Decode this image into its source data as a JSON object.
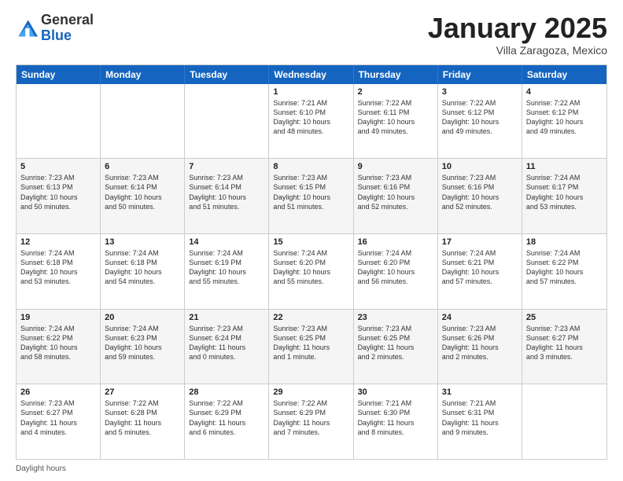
{
  "header": {
    "logo_general": "General",
    "logo_blue": "Blue",
    "month_title": "January 2025",
    "subtitle": "Villa Zaragoza, Mexico"
  },
  "days_of_week": [
    "Sunday",
    "Monday",
    "Tuesday",
    "Wednesday",
    "Thursday",
    "Friday",
    "Saturday"
  ],
  "footer_text": "Daylight hours",
  "rows": [
    [
      {
        "day": "",
        "info": "",
        "shaded": false
      },
      {
        "day": "",
        "info": "",
        "shaded": false
      },
      {
        "day": "",
        "info": "",
        "shaded": false
      },
      {
        "day": "1",
        "info": "Sunrise: 7:21 AM\nSunset: 6:10 PM\nDaylight: 10 hours\nand 48 minutes.",
        "shaded": false
      },
      {
        "day": "2",
        "info": "Sunrise: 7:22 AM\nSunset: 6:11 PM\nDaylight: 10 hours\nand 49 minutes.",
        "shaded": false
      },
      {
        "day": "3",
        "info": "Sunrise: 7:22 AM\nSunset: 6:12 PM\nDaylight: 10 hours\nand 49 minutes.",
        "shaded": false
      },
      {
        "day": "4",
        "info": "Sunrise: 7:22 AM\nSunset: 6:12 PM\nDaylight: 10 hours\nand 49 minutes.",
        "shaded": false
      }
    ],
    [
      {
        "day": "5",
        "info": "Sunrise: 7:23 AM\nSunset: 6:13 PM\nDaylight: 10 hours\nand 50 minutes.",
        "shaded": true
      },
      {
        "day": "6",
        "info": "Sunrise: 7:23 AM\nSunset: 6:14 PM\nDaylight: 10 hours\nand 50 minutes.",
        "shaded": true
      },
      {
        "day": "7",
        "info": "Sunrise: 7:23 AM\nSunset: 6:14 PM\nDaylight: 10 hours\nand 51 minutes.",
        "shaded": true
      },
      {
        "day": "8",
        "info": "Sunrise: 7:23 AM\nSunset: 6:15 PM\nDaylight: 10 hours\nand 51 minutes.",
        "shaded": true
      },
      {
        "day": "9",
        "info": "Sunrise: 7:23 AM\nSunset: 6:16 PM\nDaylight: 10 hours\nand 52 minutes.",
        "shaded": true
      },
      {
        "day": "10",
        "info": "Sunrise: 7:23 AM\nSunset: 6:16 PM\nDaylight: 10 hours\nand 52 minutes.",
        "shaded": true
      },
      {
        "day": "11",
        "info": "Sunrise: 7:24 AM\nSunset: 6:17 PM\nDaylight: 10 hours\nand 53 minutes.",
        "shaded": true
      }
    ],
    [
      {
        "day": "12",
        "info": "Sunrise: 7:24 AM\nSunset: 6:18 PM\nDaylight: 10 hours\nand 53 minutes.",
        "shaded": false
      },
      {
        "day": "13",
        "info": "Sunrise: 7:24 AM\nSunset: 6:18 PM\nDaylight: 10 hours\nand 54 minutes.",
        "shaded": false
      },
      {
        "day": "14",
        "info": "Sunrise: 7:24 AM\nSunset: 6:19 PM\nDaylight: 10 hours\nand 55 minutes.",
        "shaded": false
      },
      {
        "day": "15",
        "info": "Sunrise: 7:24 AM\nSunset: 6:20 PM\nDaylight: 10 hours\nand 55 minutes.",
        "shaded": false
      },
      {
        "day": "16",
        "info": "Sunrise: 7:24 AM\nSunset: 6:20 PM\nDaylight: 10 hours\nand 56 minutes.",
        "shaded": false
      },
      {
        "day": "17",
        "info": "Sunrise: 7:24 AM\nSunset: 6:21 PM\nDaylight: 10 hours\nand 57 minutes.",
        "shaded": false
      },
      {
        "day": "18",
        "info": "Sunrise: 7:24 AM\nSunset: 6:22 PM\nDaylight: 10 hours\nand 57 minutes.",
        "shaded": false
      }
    ],
    [
      {
        "day": "19",
        "info": "Sunrise: 7:24 AM\nSunset: 6:22 PM\nDaylight: 10 hours\nand 58 minutes.",
        "shaded": true
      },
      {
        "day": "20",
        "info": "Sunrise: 7:24 AM\nSunset: 6:23 PM\nDaylight: 10 hours\nand 59 minutes.",
        "shaded": true
      },
      {
        "day": "21",
        "info": "Sunrise: 7:23 AM\nSunset: 6:24 PM\nDaylight: 11 hours\nand 0 minutes.",
        "shaded": true
      },
      {
        "day": "22",
        "info": "Sunrise: 7:23 AM\nSunset: 6:25 PM\nDaylight: 11 hours\nand 1 minute.",
        "shaded": true
      },
      {
        "day": "23",
        "info": "Sunrise: 7:23 AM\nSunset: 6:25 PM\nDaylight: 11 hours\nand 2 minutes.",
        "shaded": true
      },
      {
        "day": "24",
        "info": "Sunrise: 7:23 AM\nSunset: 6:26 PM\nDaylight: 11 hours\nand 2 minutes.",
        "shaded": true
      },
      {
        "day": "25",
        "info": "Sunrise: 7:23 AM\nSunset: 6:27 PM\nDaylight: 11 hours\nand 3 minutes.",
        "shaded": true
      }
    ],
    [
      {
        "day": "26",
        "info": "Sunrise: 7:23 AM\nSunset: 6:27 PM\nDaylight: 11 hours\nand 4 minutes.",
        "shaded": false
      },
      {
        "day": "27",
        "info": "Sunrise: 7:22 AM\nSunset: 6:28 PM\nDaylight: 11 hours\nand 5 minutes.",
        "shaded": false
      },
      {
        "day": "28",
        "info": "Sunrise: 7:22 AM\nSunset: 6:29 PM\nDaylight: 11 hours\nand 6 minutes.",
        "shaded": false
      },
      {
        "day": "29",
        "info": "Sunrise: 7:22 AM\nSunset: 6:29 PM\nDaylight: 11 hours\nand 7 minutes.",
        "shaded": false
      },
      {
        "day": "30",
        "info": "Sunrise: 7:21 AM\nSunset: 6:30 PM\nDaylight: 11 hours\nand 8 minutes.",
        "shaded": false
      },
      {
        "day": "31",
        "info": "Sunrise: 7:21 AM\nSunset: 6:31 PM\nDaylight: 11 hours\nand 9 minutes.",
        "shaded": false
      },
      {
        "day": "",
        "info": "",
        "shaded": false
      }
    ]
  ]
}
